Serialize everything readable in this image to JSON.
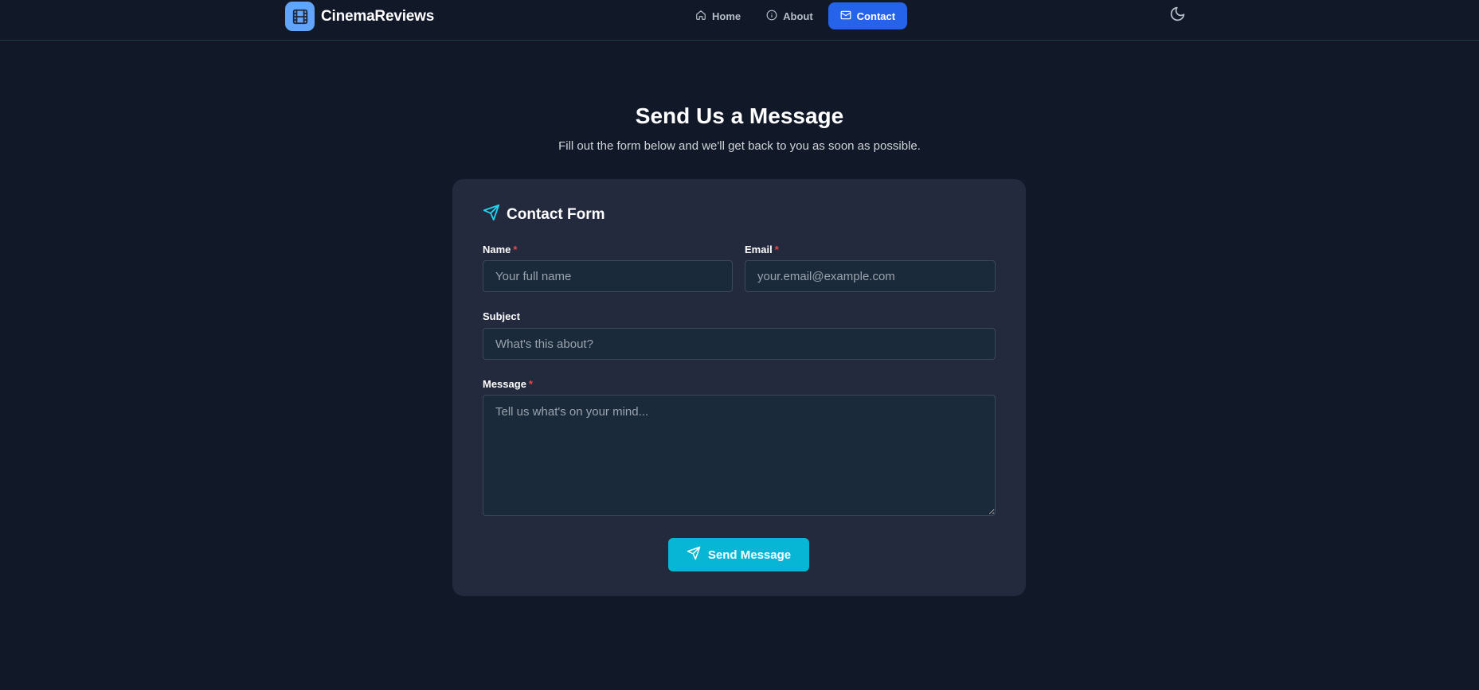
{
  "header": {
    "brand_name": "CinemaReviews",
    "brand_icon": "film-icon",
    "nav": [
      {
        "label": "Home",
        "icon": "home-icon",
        "active": false
      },
      {
        "label": "About",
        "icon": "info-icon",
        "active": false
      },
      {
        "label": "Contact",
        "icon": "mail-icon",
        "active": true
      }
    ],
    "theme_icon": "moon-icon"
  },
  "hero": {
    "title": "Send Us a Message",
    "subtitle": "Fill out the form below and we'll get back to you as soon as possible."
  },
  "form": {
    "title": "Contact Form",
    "title_icon": "send-icon",
    "required_marker": "*",
    "fields": {
      "name": {
        "label": "Name",
        "placeholder": "Your full name",
        "value": "",
        "required": true
      },
      "email": {
        "label": "Email",
        "placeholder": "your.email@example.com",
        "value": "",
        "required": true
      },
      "subject": {
        "label": "Subject",
        "placeholder": "What's this about?",
        "value": "",
        "required": false
      },
      "message": {
        "label": "Message",
        "placeholder": "Tell us what's on your mind...",
        "value": "",
        "required": true
      }
    },
    "submit_label": "Send Message",
    "submit_icon": "send-icon"
  },
  "colors": {
    "page_bg": "#111827",
    "card_bg": "#232a3d",
    "accent_blue": "#2563eb",
    "accent_cyan": "#06b6d4",
    "logo_bg": "#60a5fa",
    "required": "#ef4444"
  }
}
